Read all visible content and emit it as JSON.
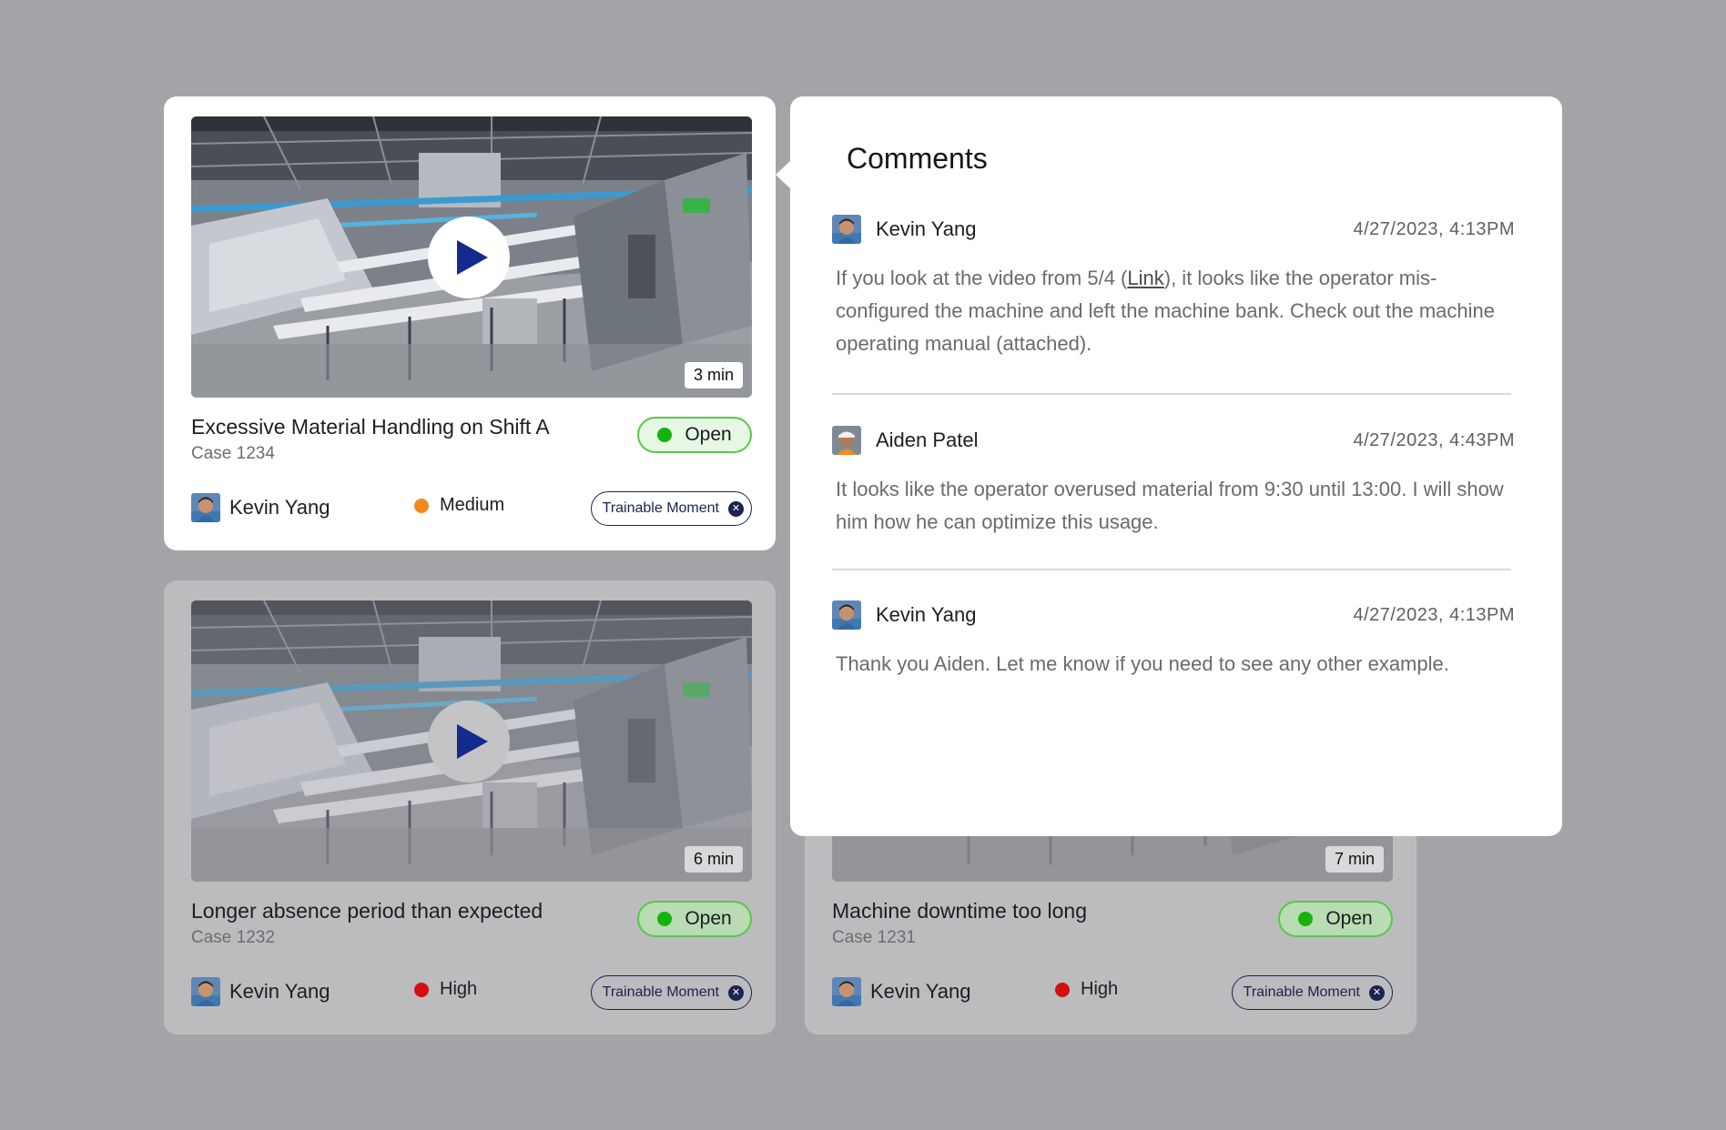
{
  "cards": [
    {
      "duration": "3 min",
      "title": "Excessive Material Handling on Shift A",
      "case": "Case 1234",
      "status": "Open",
      "assignee": "Kevin Yang",
      "priority": "Medium",
      "priority_color": "#f28a1f",
      "tag": "Trainable Moment"
    },
    {
      "duration": "6 min",
      "title": "Longer absence period than expected",
      "case": "Case 1232",
      "status": "Open",
      "assignee": "Kevin Yang",
      "priority": "High",
      "priority_color": "#d40f0f",
      "tag": "Trainable Moment"
    },
    {
      "duration": "7 min",
      "title": "Machine downtime too long",
      "case": "Case 1231",
      "status": "Open",
      "assignee": "Kevin Yang",
      "priority": "High",
      "priority_color": "#d40f0f",
      "tag": "Trainable Moment"
    }
  ],
  "comments_panel": {
    "title": "Comments",
    "comments": [
      {
        "author": "Kevin Yang",
        "time": "4/27/2023, 4:13PM",
        "text_before_link": "If you look at the video from 5/4 (",
        "link_text": "Link",
        "text_after_link": "), it looks like the operator mis-configured the machine and left the machine bank. Check out the machine operating manual (attached)."
      },
      {
        "author": "Aiden Patel",
        "time": "4/27/2023, 4:43PM",
        "text": "It looks like the operator overused material from 9:30 until 13:00. I will show him how he can optimize this usage."
      },
      {
        "author": "Kevin Yang",
        "time": "4/27/2023, 4:13PM",
        "text": "Thank you Aiden. Let me know if you need to see any other example."
      }
    ]
  },
  "icons": {
    "play": "play-icon",
    "close": "close-icon",
    "status": "status-dot",
    "priority": "priority-dot"
  },
  "colors": {
    "background": "#a3a4a8",
    "status_green": "#14b30f",
    "play_blue": "#142a8c",
    "tag_navy": "#1b2350"
  }
}
